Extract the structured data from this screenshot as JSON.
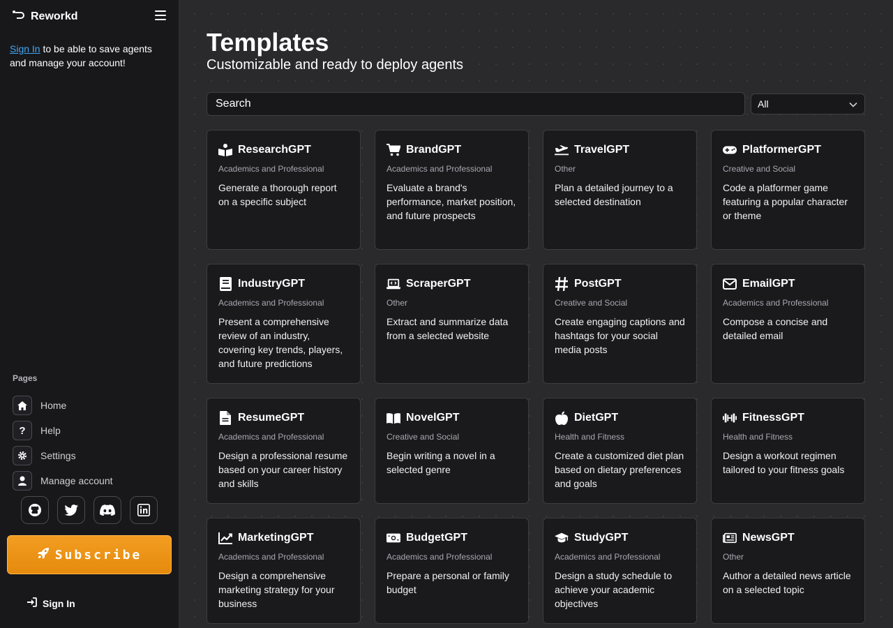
{
  "brand": {
    "name": "Reworkd"
  },
  "sidebar": {
    "signin_link": "Sign In",
    "signin_text": " to be able to save agents and manage your account!",
    "pages_label": "Pages",
    "nav": [
      {
        "label": "Home",
        "icon": "home-icon"
      },
      {
        "label": "Help",
        "icon": "question-icon"
      },
      {
        "label": "Settings",
        "icon": "gear-icon"
      },
      {
        "label": "Manage account",
        "icon": "user-icon"
      }
    ],
    "socials": [
      "github-icon",
      "twitter-icon",
      "discord-icon",
      "linkedin-icon"
    ],
    "subscribe_label": "Subscribe",
    "signin_button": "Sign In"
  },
  "header": {
    "title": "Templates",
    "subtitle": "Customizable and ready to deploy agents"
  },
  "search": {
    "placeholder": "Search"
  },
  "filter": {
    "selected": "All"
  },
  "colors": {
    "accent": "#f29d22",
    "link": "#3ea8f5",
    "card_bg": "#1a1a1d"
  },
  "cards": [
    {
      "title": "ResearchGPT",
      "category": "Academics and Professional",
      "description": "Generate a thorough report on a specific subject",
      "icon": "book-reader-icon"
    },
    {
      "title": "BrandGPT",
      "category": "Academics and Professional",
      "description": "Evaluate a brand's performance, market position, and future prospects",
      "icon": "cart-icon"
    },
    {
      "title": "TravelGPT",
      "category": "Other",
      "description": "Plan a detailed journey to a selected destination",
      "icon": "plane-icon"
    },
    {
      "title": "PlatformerGPT",
      "category": "Creative and Social",
      "description": "Code a platformer game featuring a popular character or theme",
      "icon": "gamepad-icon"
    },
    {
      "title": "IndustryGPT",
      "category": "Academics and Professional",
      "description": "Present a comprehensive review of an industry, covering key trends, players, and future predictions",
      "icon": "book-icon"
    },
    {
      "title": "ScraperGPT",
      "category": "Other",
      "description": "Extract and summarize data from a selected website",
      "icon": "laptop-code-icon"
    },
    {
      "title": "PostGPT",
      "category": "Creative and Social",
      "description": "Create engaging captions and hashtags for your social media posts",
      "icon": "hashtag-icon"
    },
    {
      "title": "EmailGPT",
      "category": "Academics and Professional",
      "description": "Compose a concise and detailed email",
      "icon": "envelope-icon"
    },
    {
      "title": "ResumeGPT",
      "category": "Academics and Professional",
      "description": "Design a professional resume based on your career history and skills",
      "icon": "document-icon"
    },
    {
      "title": "NovelGPT",
      "category": "Creative and Social",
      "description": "Begin writing a novel in a selected genre",
      "icon": "open-book-icon"
    },
    {
      "title": "DietGPT",
      "category": "Health and Fitness",
      "description": "Create a customized diet plan based on dietary preferences and goals",
      "icon": "apple-icon"
    },
    {
      "title": "FitnessGPT",
      "category": "Health and Fitness",
      "description": "Design a workout regimen tailored to your fitness goals",
      "icon": "dumbbell-icon"
    },
    {
      "title": "MarketingGPT",
      "category": "Academics and Professional",
      "description": "Design a comprehensive marketing strategy for your business",
      "icon": "chart-line-icon"
    },
    {
      "title": "BudgetGPT",
      "category": "Academics and Professional",
      "description": "Prepare a personal or family budget",
      "icon": "money-icon"
    },
    {
      "title": "StudyGPT",
      "category": "Academics and Professional",
      "description": "Design a study schedule to achieve your academic objectives",
      "icon": "graduation-cap-icon"
    },
    {
      "title": "NewsGPT",
      "category": "Other",
      "description": "Author a detailed news article on a selected topic",
      "icon": "newspaper-icon"
    }
  ]
}
